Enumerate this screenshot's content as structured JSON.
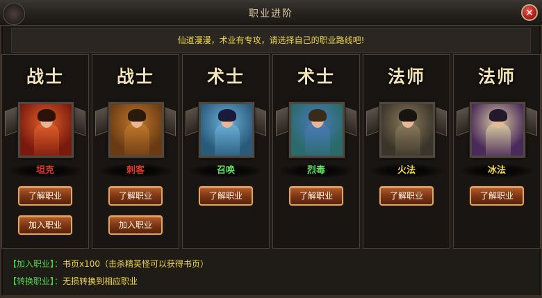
{
  "window": {
    "title": "职业进阶",
    "close_symbol": "✕"
  },
  "tagline": "仙道漫漫，术业有专攻，请选择自己的职业路线吧!",
  "colors": {
    "gold": "#f0d84a",
    "green": "#4ed64e",
    "red": "#e23a2a",
    "button": "#7a3514"
  },
  "cards": [
    {
      "name": "战士",
      "sub": "坦克",
      "sub_color": "#e23a2a",
      "learn": "了解职业",
      "join": "加入职业",
      "has_join": true,
      "art": {
        "bg": "#7a1a0e",
        "accent": "#e0602a",
        "hair": "#2a1208"
      }
    },
    {
      "name": "战士",
      "sub": "刺客",
      "sub_color": "#e23a2a",
      "learn": "了解职业",
      "join": "加入职业",
      "has_join": true,
      "art": {
        "bg": "#6a3a14",
        "accent": "#c0782a",
        "hair": "#2a1a0c"
      }
    },
    {
      "name": "术士",
      "sub": "召唤",
      "sub_color": "#5ee05e",
      "learn": "了解职业",
      "join": "",
      "has_join": false,
      "art": {
        "bg": "#2a5a7a",
        "accent": "#6ab0d8",
        "hair": "#1a1a3a"
      }
    },
    {
      "name": "术士",
      "sub": "烈毒",
      "sub_color": "#5ee05e",
      "learn": "了解职业",
      "join": "",
      "has_join": false,
      "art": {
        "bg": "#2a6a6a",
        "accent": "#4a7ab8",
        "hair": "#3a2a1a"
      }
    },
    {
      "name": "法师",
      "sub": "火法",
      "sub_color": "#f0d84a",
      "learn": "了解职业",
      "join": "",
      "has_join": false,
      "art": {
        "bg": "#3a342a",
        "accent": "#8a7a5a",
        "hair": "#181410"
      }
    },
    {
      "name": "法师",
      "sub": "冰法",
      "sub_color": "#f0d84a",
      "learn": "了解职业",
      "join": "",
      "has_join": false,
      "art": {
        "bg": "#4a2a5a",
        "accent": "#d8c8a0",
        "hair": "#221a2a"
      }
    }
  ],
  "footer": [
    {
      "key": "【加入职业】：",
      "value": "书页x100（击杀精英怪可以获得书页）"
    },
    {
      "key": "【转换职业】：",
      "value": "无损转换到相应职业"
    }
  ]
}
